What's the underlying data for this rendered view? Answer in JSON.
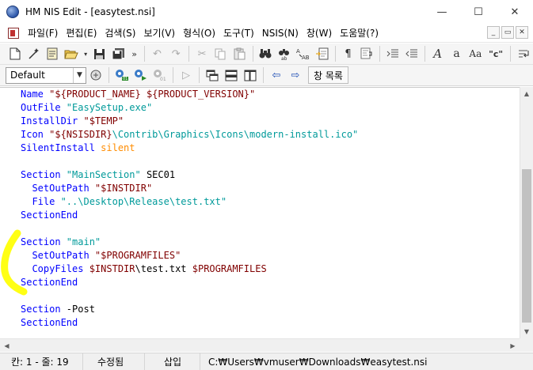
{
  "window": {
    "title": "HM NIS Edit - [easytest.nsi]",
    "minimize_glyph": "—",
    "maximize_glyph": "☐",
    "close_glyph": "✕"
  },
  "menu": {
    "items": [
      "파일(F)",
      "편집(E)",
      "검색(S)",
      "보기(V)",
      "형식(O)",
      "도구(T)",
      "NSIS(N)",
      "창(W)",
      "도움말(?)"
    ],
    "mdi_minimize": "_",
    "mdi_restore": "▭",
    "mdi_close": "✕"
  },
  "toolbar1": {
    "icons": [
      "new-file-icon",
      "wizard-icon",
      "template-icon",
      "open-icon",
      "save-icon",
      "save-all-icon",
      "more-icon",
      "undo-icon",
      "redo-icon",
      "cut-icon",
      "copy-icon",
      "paste-icon",
      "find-icon",
      "find-replace-icon",
      "replace-icon",
      "insert-file-icon",
      "paragraph-icon",
      "word-wrap-icon",
      "indent-icon",
      "outdent-icon",
      "italic-a-icon",
      "lowercase-icon",
      "quote-c-icon",
      "return-icon"
    ],
    "quote_label": "\"c\""
  },
  "toolbar2": {
    "style_value": "Default",
    "window_label": "창 목록"
  },
  "editor": {
    "lines": [
      {
        "parts": [
          {
            "t": "Name ",
            "c": "kw"
          },
          {
            "t": "\"${PRODUCT_NAME} ${PRODUCT_VERSION}\"",
            "c": "var"
          }
        ]
      },
      {
        "parts": [
          {
            "t": "OutFile ",
            "c": "kw"
          },
          {
            "t": "\"EasySetup.exe\"",
            "c": "str"
          }
        ]
      },
      {
        "parts": [
          {
            "t": "InstallDir ",
            "c": "kw"
          },
          {
            "t": "\"$TEMP\"",
            "c": "var"
          }
        ]
      },
      {
        "parts": [
          {
            "t": "Icon ",
            "c": "kw"
          },
          {
            "t": "\"${NSISDIR}",
            "c": "var"
          },
          {
            "t": "\\Contrib\\Graphics\\Icons\\modern-install.ico\"",
            "c": "str"
          }
        ]
      },
      {
        "parts": [
          {
            "t": "SilentInstall ",
            "c": "kw"
          },
          {
            "t": "silent",
            "c": "arg"
          }
        ]
      },
      {
        "parts": []
      },
      {
        "parts": [
          {
            "t": "Section ",
            "c": "kw"
          },
          {
            "t": "\"MainSection\"",
            "c": "str"
          },
          {
            "t": " SEC01",
            "c": "plain"
          }
        ]
      },
      {
        "parts": [
          {
            "t": "  SetOutPath ",
            "c": "kw"
          },
          {
            "t": "\"$INSTDIR\"",
            "c": "var"
          }
        ]
      },
      {
        "parts": [
          {
            "t": "  File ",
            "c": "kw"
          },
          {
            "t": "\"..\\Desktop\\Release\\test.txt\"",
            "c": "str"
          }
        ]
      },
      {
        "parts": [
          {
            "t": "SectionEnd",
            "c": "kw"
          }
        ]
      },
      {
        "parts": []
      },
      {
        "parts": [
          {
            "t": "Section ",
            "c": "kw"
          },
          {
            "t": "\"main\"",
            "c": "str"
          }
        ]
      },
      {
        "parts": [
          {
            "t": "  SetOutPath ",
            "c": "kw"
          },
          {
            "t": "\"$PROGRAMFILES\"",
            "c": "var"
          }
        ]
      },
      {
        "parts": [
          {
            "t": "  CopyFiles ",
            "c": "kw"
          },
          {
            "t": "$INSTDIR",
            "c": "var"
          },
          {
            "t": "\\test.txt ",
            "c": "plain"
          },
          {
            "t": "$PROGRAMFILES",
            "c": "var"
          }
        ]
      },
      {
        "parts": [
          {
            "t": "SectionEnd",
            "c": "kw"
          }
        ]
      },
      {
        "parts": []
      },
      {
        "parts": [
          {
            "t": "Section ",
            "c": "kw"
          },
          {
            "t": "-Post",
            "c": "plain"
          }
        ]
      },
      {
        "parts": [
          {
            "t": "SectionEnd",
            "c": "kw"
          }
        ]
      }
    ]
  },
  "scrollbars": {
    "up": "▲",
    "down": "▼",
    "left": "◀",
    "right": "▶"
  },
  "status": {
    "position": "칸: 1 - 줄: 19",
    "modified": "수정됨",
    "insert_mode": "삽입",
    "file_path": "C:₩Users₩vmuser₩Downloads₩easytest.nsi"
  },
  "colors": {
    "keyword": "#0000ff",
    "string": "#009a9a",
    "variable": "#800000",
    "argument": "#ff8c00",
    "highlighter": "#ffff00"
  }
}
